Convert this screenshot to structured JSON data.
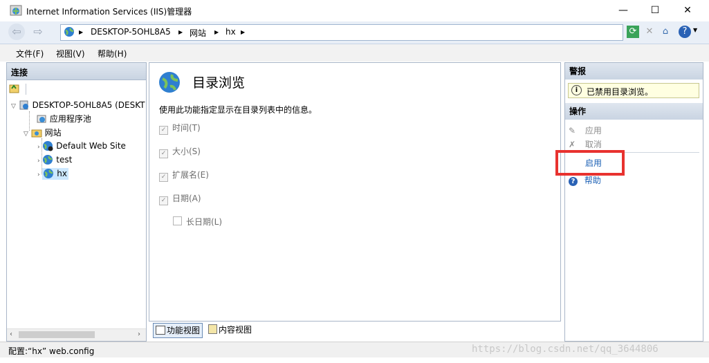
{
  "window": {
    "title": "Internet Information Services (IIS)管理器"
  },
  "address": {
    "crumbs": [
      "DESKTOP-5OHL8A5",
      "网站",
      "hx"
    ]
  },
  "menu": {
    "items": [
      "文件(F)",
      "视图(V)",
      "帮助(H)"
    ]
  },
  "connections": {
    "header": "连接",
    "tree": {
      "server": "DESKTOP-5OHL8A5 (DESKT",
      "app_pools": "应用程序池",
      "sites": "网站",
      "site_items": [
        "Default Web Site",
        "test",
        "hx"
      ]
    }
  },
  "feature": {
    "title": "目录浏览",
    "description": "使用此功能指定显示在目录列表中的信息。",
    "options": [
      {
        "label": "时间(T)",
        "checked": true
      },
      {
        "label": "大小(S)",
        "checked": true
      },
      {
        "label": "扩展名(E)",
        "checked": true
      },
      {
        "label": "日期(A)",
        "checked": true
      }
    ],
    "sub_option": {
      "label": "长日期(L)",
      "checked": false
    }
  },
  "view_tabs": {
    "features": "功能视图",
    "content": "内容视图"
  },
  "alerts": {
    "header": "警报",
    "message": "已禁用目录浏览。"
  },
  "actions": {
    "header": "操作",
    "apply": "应用",
    "cancel": "取消",
    "enable": "启用",
    "help": "帮助"
  },
  "status": {
    "text": "配置:“hx” web.config"
  },
  "watermark": "https://blog.csdn.net/qq_3644806",
  "colors": {
    "highlight": "#e8322f",
    "link": "#1a5fb4",
    "alert_bg": "#ffffe1"
  }
}
